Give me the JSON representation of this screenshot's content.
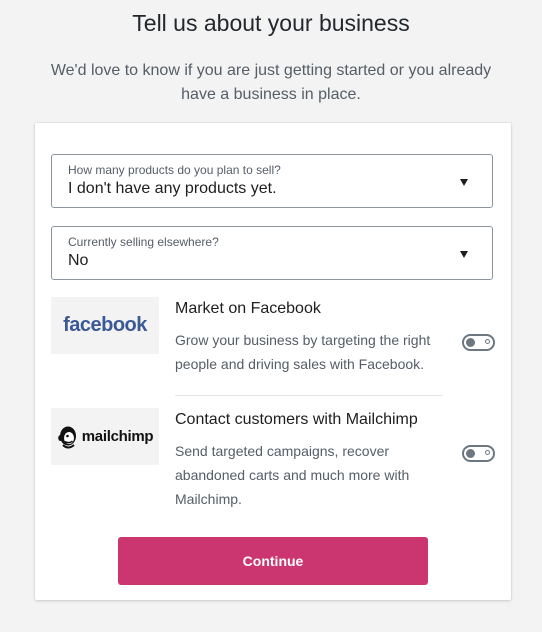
{
  "header": {
    "title": "Tell us about your business",
    "subtitle": "We'd love to know if you are just getting started or you already have a business in place."
  },
  "form": {
    "products": {
      "label": "How many products do you plan to sell?",
      "value": "I don't have any products yet."
    },
    "selling": {
      "label": "Currently selling elsewhere?",
      "value": "No"
    }
  },
  "extensions": [
    {
      "logo": "facebook",
      "logo_color": "#3b5998",
      "title": "Market on Facebook",
      "description": "Grow your business by targeting the right people and driving sales with Facebook.",
      "enabled": false
    },
    {
      "logo": "mailchimp",
      "title": "Contact customers with Mailchimp",
      "description": "Send targeted campaigns, recover abandoned carts and much more with Mailchimp.",
      "enabled": false
    }
  ],
  "actions": {
    "continue_label": "Continue",
    "continue_color": "#cc3670"
  },
  "icons": {
    "select_caret": "caret-down-icon",
    "toggle": "toggle-off-icon"
  }
}
